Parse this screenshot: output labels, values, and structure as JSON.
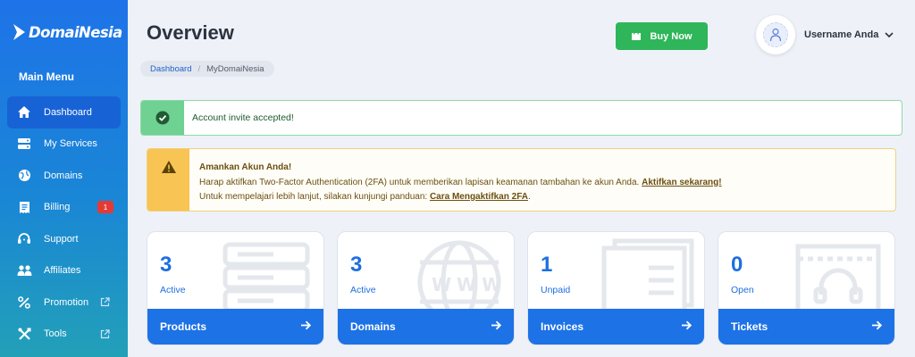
{
  "brand": {
    "name": "DomaiNesia"
  },
  "sidebar": {
    "menu_title": "Main Menu",
    "items": [
      {
        "label": "Dashboard",
        "icon": "home-icon",
        "active": true
      },
      {
        "label": "My Services",
        "icon": "server-icon"
      },
      {
        "label": "Domains",
        "icon": "globe-icon"
      },
      {
        "label": "Billing",
        "icon": "receipt-icon",
        "badge": "1"
      },
      {
        "label": "Support",
        "icon": "headset-icon"
      },
      {
        "label": "Affiliates",
        "icon": "users-icon"
      },
      {
        "label": "Promotion",
        "icon": "percent-icon",
        "external": true
      },
      {
        "label": "Tools",
        "icon": "tools-icon",
        "external": true
      }
    ]
  },
  "header": {
    "title": "Overview",
    "breadcrumb": [
      "Dashboard",
      "MyDomaiNesia"
    ],
    "buy_button": "Buy Now",
    "username": "Username Anda"
  },
  "alerts": {
    "success": "Account invite accepted!",
    "warning": {
      "title": "Amankan Akun Anda!",
      "line1": "Harap aktifkan Two-Factor Authentication (2FA) untuk memberikan lapisan keamanan tambahan ke akun Anda.",
      "link1": "Aktifkan sekarang!",
      "line2": "Untuk mempelajari lebih lanjut, silakan kunjungi panduan:",
      "link2": "Cara Mengaktifkan 2FA",
      "line2_end": "."
    }
  },
  "cards": [
    {
      "count": "3",
      "status": "Active",
      "label": "Products",
      "icon": "server-icon"
    },
    {
      "count": "3",
      "status": "Active",
      "label": "Domains",
      "icon": "globe-www-icon"
    },
    {
      "count": "1",
      "status": "Unpaid",
      "label": "Invoices",
      "icon": "invoice-icon"
    },
    {
      "count": "0",
      "status": "Open",
      "label": "Tickets",
      "icon": "ticket-support-icon"
    }
  ],
  "colors": {
    "primary": "#1d72e6",
    "success": "#2fb55a",
    "warning": "#f8c453",
    "danger": "#e53935"
  }
}
